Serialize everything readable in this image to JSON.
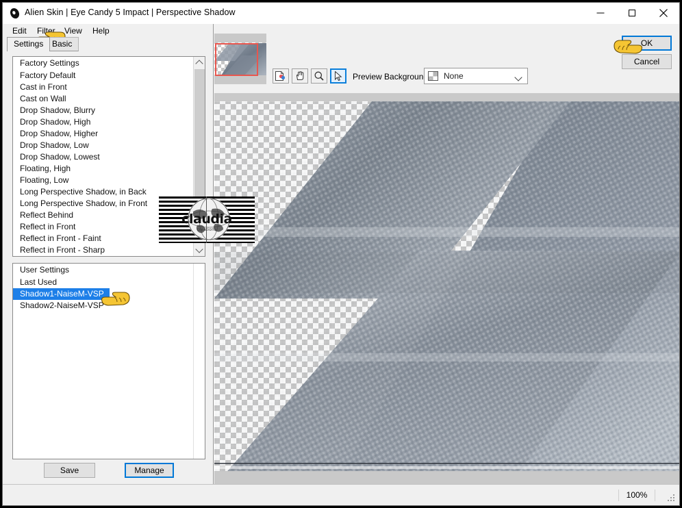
{
  "window": {
    "title": "Alien Skin | Eye Candy 5 Impact | Perspective Shadow",
    "app_icon": "alien-skin-icon",
    "minimize_label": "Minimize",
    "maximize_label": "Maximize",
    "close_label": "Close"
  },
  "menubar": {
    "items": [
      {
        "label": "Edit"
      },
      {
        "label": "Filter"
      },
      {
        "label": "View"
      },
      {
        "label": "Help"
      }
    ]
  },
  "tabs": [
    {
      "label": "Settings",
      "active": true
    },
    {
      "label": "Basic",
      "active": false
    }
  ],
  "factory_list": {
    "header": "Factory Settings",
    "items": [
      "Factory Default",
      "Cast in Front",
      "Cast on Wall",
      "Drop Shadow, Blurry",
      "Drop Shadow, High",
      "Drop Shadow, Higher",
      "Drop Shadow, Low",
      "Drop Shadow, Lowest",
      "Floating, High",
      "Floating, Low",
      "Long Perspective Shadow, in Back",
      "Long Perspective Shadow, in Front",
      "Reflect Behind",
      "Reflect in Front",
      "Reflect in Front - Faint",
      "Reflect in Front - Sharp"
    ]
  },
  "user_list": {
    "header": "User Settings",
    "items": [
      {
        "label": "Last Used",
        "selected": false
      },
      {
        "label": "Shadow1-NaiseM-VSP",
        "selected": true
      },
      {
        "label": "Shadow2-NaiseM-VSP",
        "selected": false
      }
    ]
  },
  "left_buttons": {
    "save_label": "Save",
    "manage_label": "Manage"
  },
  "toolbar": {
    "tools": [
      {
        "name": "compare-tool",
        "active": false
      },
      {
        "name": "hand-tool",
        "active": false
      },
      {
        "name": "zoom-tool",
        "active": false
      },
      {
        "name": "arrow-tool",
        "active": true
      }
    ],
    "preview_background_label": "Preview Background:",
    "preview_background_value": "None"
  },
  "dialog_buttons": {
    "ok_label": "OK",
    "cancel_label": "Cancel"
  },
  "statusbar": {
    "zoom_level": "100%"
  },
  "watermark": {
    "text": "claudia",
    "subtext": "creations"
  },
  "colors": {
    "accent_focus": "#0078d7",
    "selection_blue": "#1d7fe8",
    "viewport_rect_red": "#e8564e",
    "window_bg": "#f0f0f0",
    "shadow_gray": "#8d98a6"
  }
}
